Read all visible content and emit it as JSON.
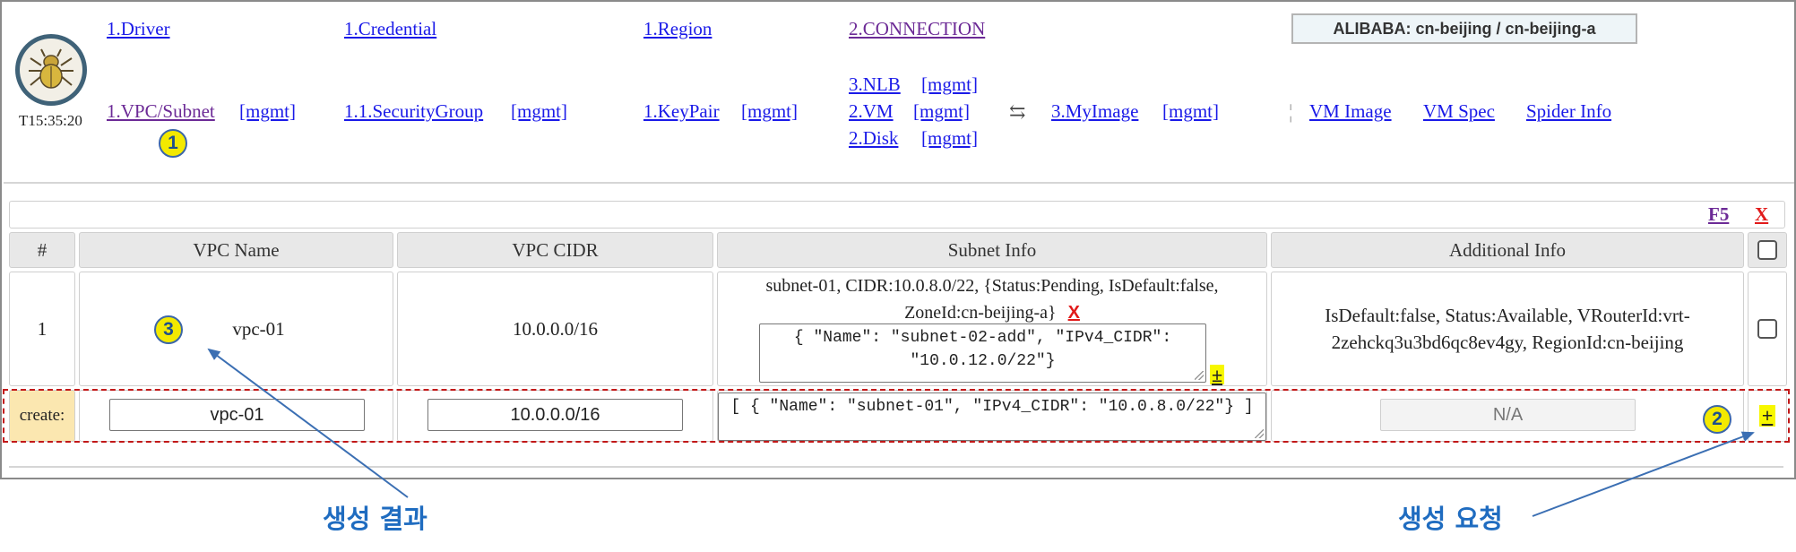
{
  "header": {
    "clock": "T15:35:20",
    "connection_label": "ALIBABA: cn-beijing / cn-beijing-a",
    "links": {
      "driver": "1.Driver",
      "credential": "1.Credential",
      "region": "1.Region",
      "connection": "2.CONNECTION",
      "vpc_subnet": "1.VPC/Subnet",
      "security_group": "1.1.SecurityGroup",
      "keypair": "1.KeyPair",
      "nlb": "3.NLB",
      "vm": "2.VM",
      "disk": "2.Disk",
      "my_image": "3.MyImage",
      "vm_image": "VM Image",
      "vm_spec": "VM Spec",
      "spider_info": "Spider Info",
      "mgmt": "[mgmt]"
    },
    "swap_symbol": "⇆",
    "divider_symbol": "¦"
  },
  "toolbar": {
    "refresh": "F5",
    "close": "X"
  },
  "table": {
    "columns": [
      "#",
      "VPC Name",
      "VPC CIDR",
      "Subnet Info",
      "Additional Info"
    ],
    "rows": [
      {
        "index": "1",
        "vpc_name": "vpc-01",
        "vpc_cidr": "10.0.0.0/16",
        "subnet_info": "subnet-01, CIDR:10.0.8.0/22, {Status:Pending, IsDefault:false, ZoneId:cn-beijing-a}",
        "subnet_delete": "X",
        "subnet_add_value": "{ \"Name\": \"subnet-02-add\", \"IPv4_CIDR\": \"10.0.12.0/22\"}",
        "subnet_add_button": "±",
        "additional_info": "IsDefault:false, Status:Available, VRouterId:vrt-2zehckq3u3bd6qc8ev4gy, RegionId:cn-beijing",
        "checked": false
      }
    ],
    "create_row": {
      "label": "create:",
      "vpc_name": "vpc-01",
      "vpc_cidr": "10.0.0.0/16",
      "subnet_json": "[ { \"Name\": \"subnet-01\", \"IPv4_CIDR\": \"10.0.8.0/22\"} ]",
      "additional_placeholder": "N/A",
      "add_button": "+"
    }
  },
  "annotations": {
    "marker_1": "1",
    "marker_2": "2",
    "marker_3": "3",
    "result_label": "생성 결과",
    "request_label": "생성 요청"
  },
  "colors": {
    "link": "#1a1ae8",
    "visited_link": "#6c2a96",
    "delete_red": "#e11a1a",
    "annotation_blue": "#1f6cc0",
    "marker_yellow": "#f3e900",
    "create_label_bg": "#fbe7b0"
  }
}
